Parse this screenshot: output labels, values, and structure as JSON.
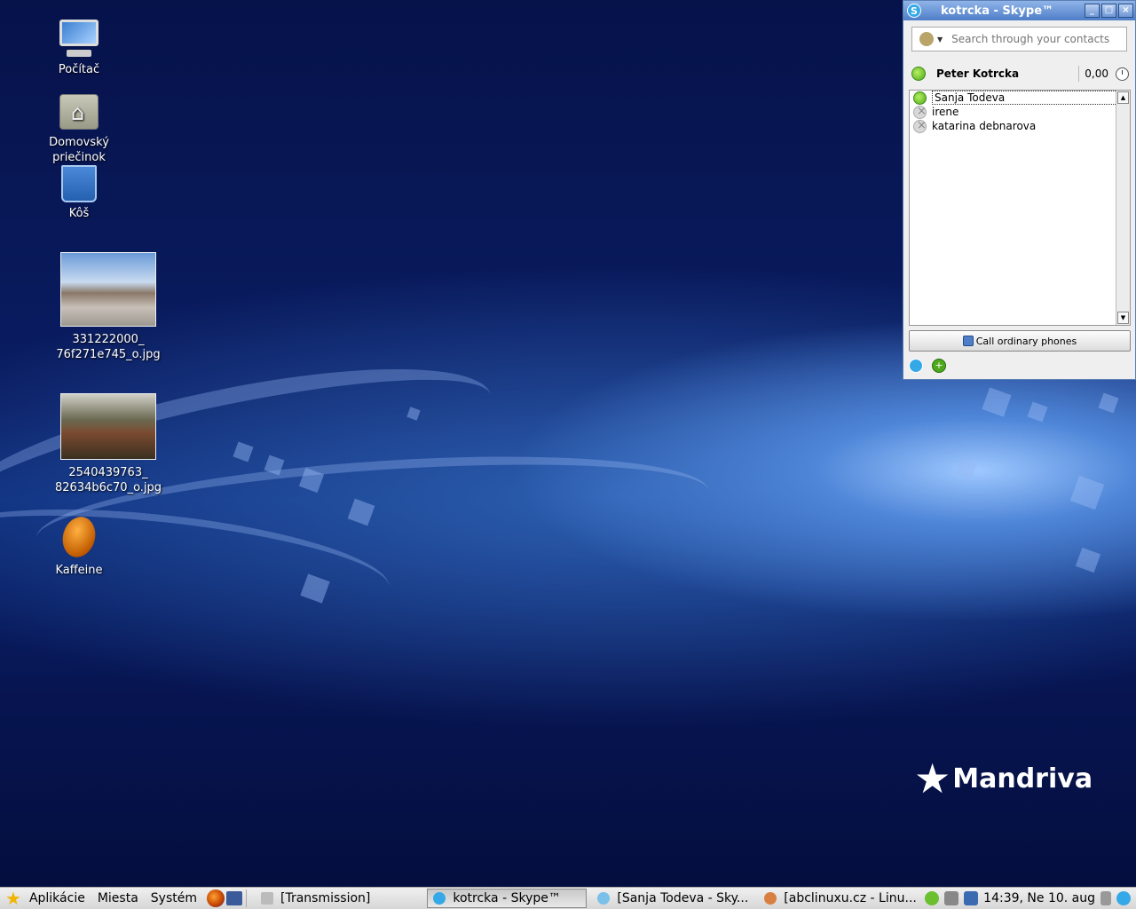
{
  "desktop": {
    "icons": [
      {
        "label": "Počítač"
      },
      {
        "label": "Domovský priečinok"
      },
      {
        "label": "Kôš"
      },
      {
        "label": "331222000_ 76f271e745_o.jpg"
      },
      {
        "label": "2540439763_ 82634b6c70_o.jpg"
      },
      {
        "label": "Kaffeine"
      }
    ],
    "brand": "Mandriva"
  },
  "skype": {
    "title": "kotrcka - Skype™",
    "search_placeholder": "Search through your contacts",
    "user_name": "Peter Kotrcka",
    "credit": "0,00",
    "contacts": [
      {
        "name": "Sanja Todeva",
        "status": "online"
      },
      {
        "name": "irene",
        "status": "offline"
      },
      {
        "name": "katarina debnarova",
        "status": "offline"
      }
    ],
    "call_button": "Call ordinary phones"
  },
  "taskbar": {
    "menus": [
      "Aplikácie",
      "Miesta",
      "Systém"
    ],
    "tasks": [
      {
        "label": "[Transmission]"
      },
      {
        "label": "kotrcka - Skype™"
      },
      {
        "label": "[Sanja Todeva - Sky..."
      },
      {
        "label": "[abclinuxu.cz - Linu..."
      }
    ],
    "clock": "14:39, Ne 10. aug"
  }
}
